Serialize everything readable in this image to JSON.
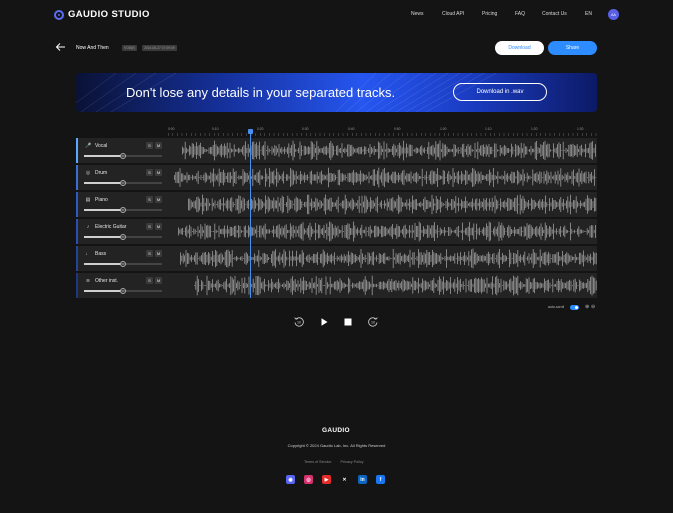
{
  "header": {
    "brand": "GAUDIO STUDIO",
    "nav": [
      "News",
      "Cloud API",
      "Pricing",
      "FAQ",
      "Contact Us",
      "EN"
    ],
    "avatar_initials": "AA"
  },
  "project": {
    "title": "Now And Then",
    "badge_format": "VOB(E)",
    "badge_date": "2024-08-27 07:09:09",
    "download_label": "Download",
    "share_label": "Share"
  },
  "banner": {
    "text": "Don't lose any details in your separated tracks.",
    "button_label": "Download in .wav"
  },
  "ruler": {
    "labels": [
      "0:00",
      "0:10",
      "0:20",
      "0:30",
      "0:40",
      "0:50",
      "1:00",
      "1:10",
      "1:20",
      "1:30"
    ]
  },
  "tracks": [
    {
      "name": "Vocal",
      "icon": "microphone-icon",
      "glyph": "🎤",
      "color": "#5aa9ff",
      "volume": "50",
      "solo": "S",
      "mute": "M"
    },
    {
      "name": "Drum",
      "icon": "drum-icon",
      "glyph": "◎",
      "color": "#3a6fd8",
      "volume": "50",
      "solo": "S",
      "mute": "M"
    },
    {
      "name": "Piano",
      "icon": "piano-icon",
      "glyph": "▤",
      "color": "#2f5ac4",
      "volume": "50",
      "solo": "S",
      "mute": "M"
    },
    {
      "name": "Electric Guitar",
      "icon": "guitar-icon",
      "glyph": "♪",
      "color": "#2a4fb0",
      "volume": "50",
      "solo": "S",
      "mute": "M"
    },
    {
      "name": "Bass",
      "icon": "bass-guitar-icon",
      "glyph": "♩",
      "color": "#24439a",
      "volume": "50",
      "solo": "S",
      "mute": "M"
    },
    {
      "name": "Other inst.",
      "icon": "waveform-icon",
      "glyph": "≋",
      "color": "#1d3784",
      "volume": "50",
      "solo": "S",
      "mute": "M"
    }
  ],
  "controls": {
    "auto_scroll_label": "auto-scroll",
    "auto_scroll_on": true,
    "rewind_label": "10",
    "forward_label": "10"
  },
  "footer": {
    "brand": "GAUDIO",
    "copyright": "Copyright © 2024 Gaudio Lab, Inc. All Rights Reserved",
    "terms": "Terms of Service",
    "privacy": "Privacy Policy",
    "socials": [
      {
        "icon": "discord-icon",
        "glyph": "◉",
        "color": "#5865f2"
      },
      {
        "icon": "instagram-icon",
        "glyph": "◎",
        "color": "#d6306e"
      },
      {
        "icon": "youtube-icon",
        "glyph": "▶",
        "color": "#e62b2b"
      },
      {
        "icon": "x-icon",
        "glyph": "✕",
        "color": "#141414"
      },
      {
        "icon": "linkedin-icon",
        "glyph": "in",
        "color": "#0a66c2"
      },
      {
        "icon": "facebook-icon",
        "glyph": "f",
        "color": "#1877f2"
      }
    ]
  }
}
